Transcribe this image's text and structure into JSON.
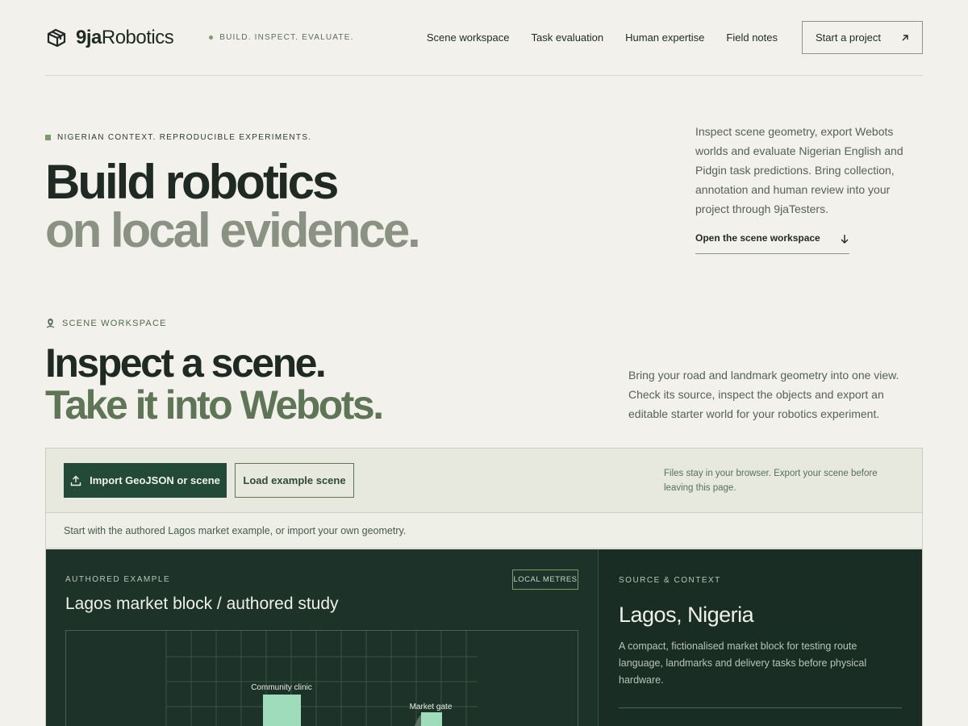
{
  "header": {
    "brand_prefix": "9ja",
    "brand_suffix": "Robotics",
    "tagline": "BUILD. INSPECT. EVALUATE.",
    "nav": [
      "Scene workspace",
      "Task evaluation",
      "Human expertise",
      "Field notes"
    ],
    "cta": "Start a project"
  },
  "hero": {
    "eyebrow": "NIGERIAN CONTEXT. REPRODUCIBLE EXPERIMENTS.",
    "title_line1": "Build robotics",
    "title_line2": "on local evidence.",
    "description": "Inspect scene geometry, export Webots worlds and evaluate Nigerian English and Pidgin task predictions. Bring collection, annotation and human review into your project through 9jaTesters.",
    "link": "Open the scene workspace"
  },
  "scene_section": {
    "eyebrow": "SCENE WORKSPACE",
    "title_line1": "Inspect a scene.",
    "title_line2": "Take it into Webots.",
    "description": "Bring your road and landmark geometry into one view. Check its source, inspect the objects and export an editable starter world for your robotics experiment."
  },
  "workspace": {
    "import_button": "Import GeoJSON or scene",
    "example_button": "Load example scene",
    "note": "Files stay in your browser. Export your scene before leaving this page.",
    "info": "Start with the authored Lagos market example, or import your own geometry.",
    "scene": {
      "eyebrow": "AUTHORED EXAMPLE",
      "badge": "LOCAL METRES",
      "title": "Lagos market block / authored study",
      "landmarks": [
        "Community clinic",
        "Market gate"
      ]
    },
    "context": {
      "eyebrow": "SOURCE & CONTEXT",
      "title": "Lagos, Nigeria",
      "description": "A compact, fictionalised market block for testing route language, landmarks and delivery tasks before physical hardware."
    }
  },
  "colors": {
    "accent": "#7c9a6a",
    "primary_button": "#234a37",
    "dark_panel": "#1d3229",
    "landmark": "#9fdcbc"
  }
}
